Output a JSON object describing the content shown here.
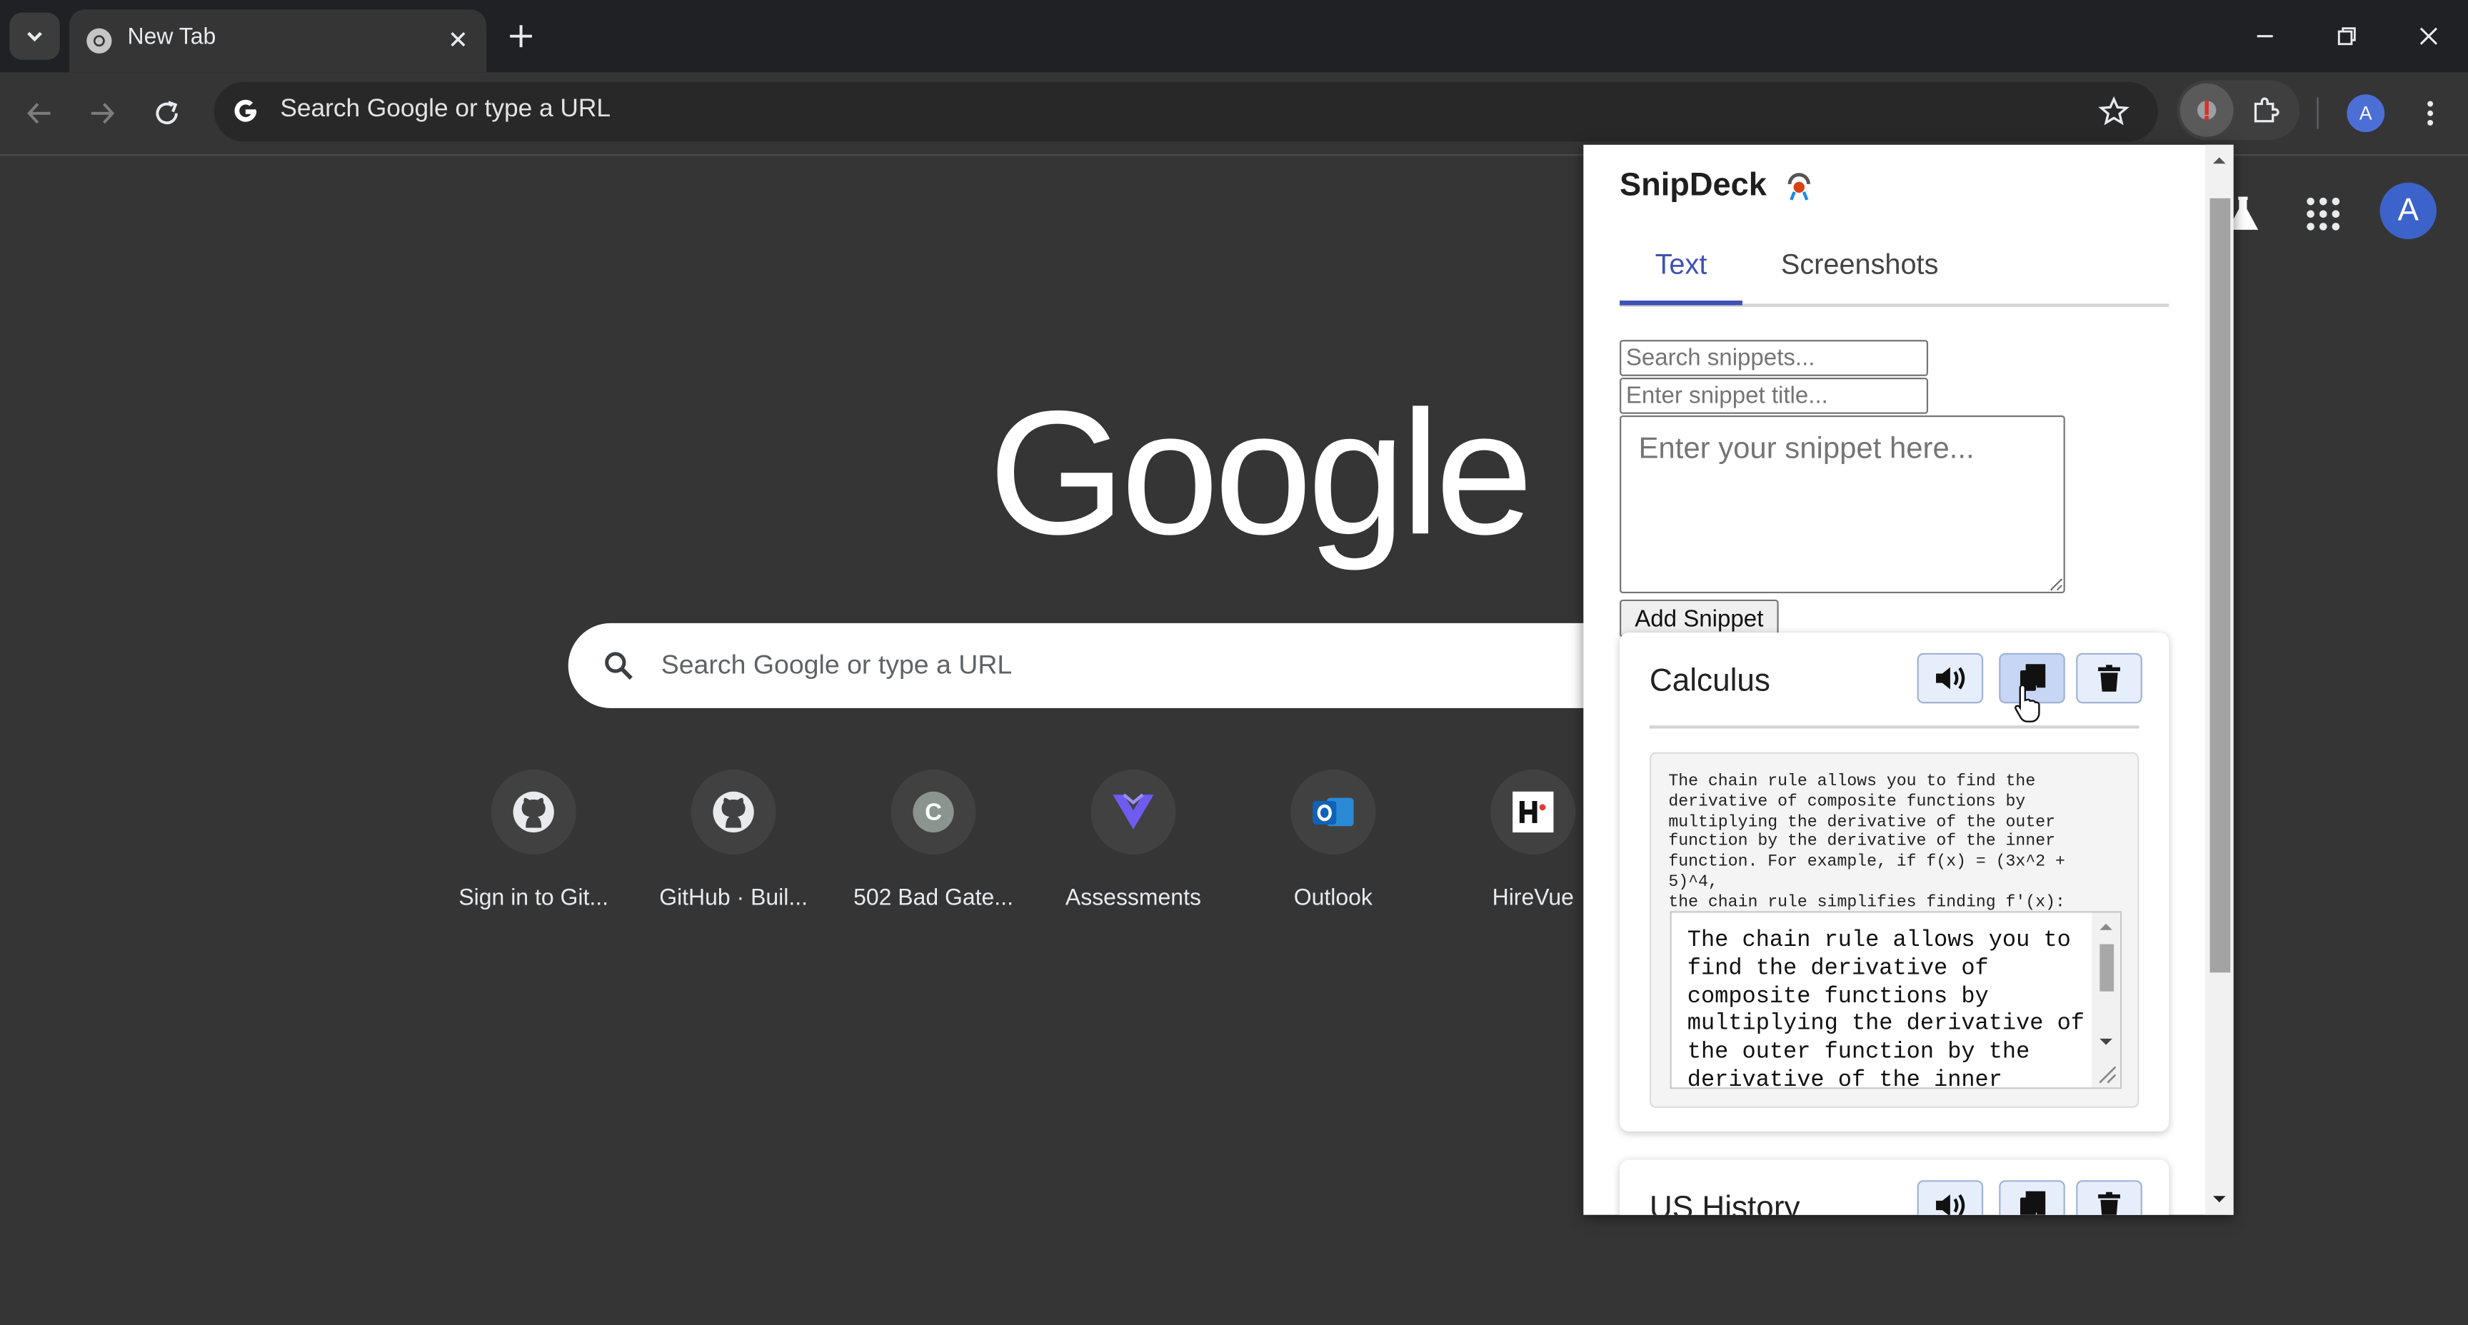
{
  "browser": {
    "tab": {
      "title": "New Tab"
    },
    "omnibox": {
      "text": "Search Google or type a URL"
    },
    "profile_initial": "A"
  },
  "ntp": {
    "logo": "Google",
    "search_placeholder": "Search Google or type a URL",
    "profile_initial": "A",
    "shortcuts": [
      {
        "label": "Sign in to Git...",
        "icon": "github-icon"
      },
      {
        "label": "GitHub · Buil...",
        "icon": "github-icon"
      },
      {
        "label": "502 Bad Gate...",
        "icon": "letter-c-icon",
        "letter": "C"
      },
      {
        "label": "Assessments",
        "icon": "assessments-icon"
      },
      {
        "label": "Outlook",
        "icon": "outlook-icon"
      },
      {
        "label": "HireVue",
        "icon": "hirevue-icon"
      }
    ]
  },
  "popup": {
    "title": "SnipDeck",
    "tabs": {
      "text": "Text",
      "screenshots": "Screenshots",
      "active": "Text"
    },
    "search_placeholder": "Search snippets...",
    "title_placeholder": "Enter snippet title...",
    "snippet_placeholder": "Enter your snippet here...",
    "add_button": "Add Snippet",
    "snippets": [
      {
        "title": "Calculus",
        "preview": "The chain rule allows you to find the\nderivative of composite functions by\nmultiplying the derivative of the outer\nfunction by the derivative of the inner\nfunction. For example, if f(x) = (3x^2 + 5)^4,\nthe chain rule simplifies finding f'(x):",
        "editor_text": "The chain rule allows you to find the derivative of composite functions by multiplying the derivative of the outer function by the derivative of the inner function. For example, if f(x) = (3x^2 + 5)^4, the chain rule simplifies finding f'(x):"
      },
      {
        "title": "US History"
      }
    ]
  },
  "colors": {
    "accent": "#3f51b5",
    "chrome_dark": "#202124",
    "ntp_background": "#353535",
    "card_button_bg": "#e7eefb"
  }
}
